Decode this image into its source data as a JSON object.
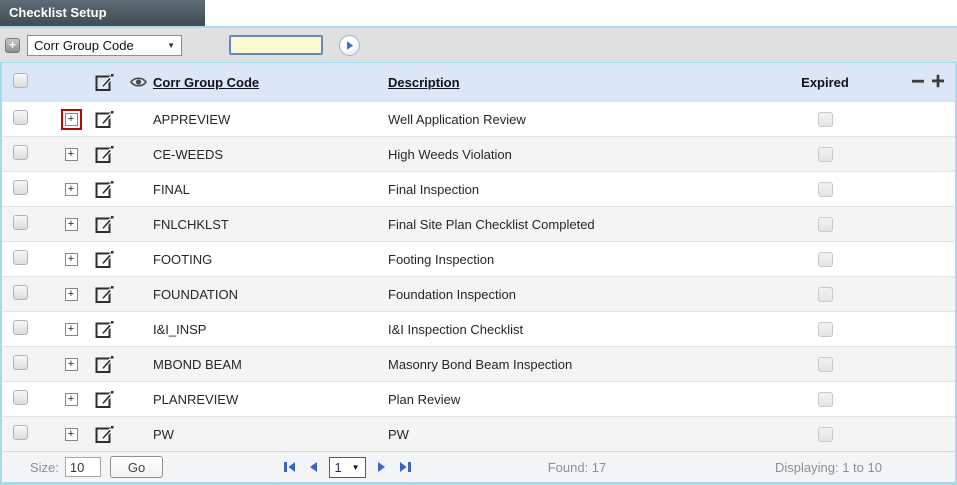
{
  "panel": {
    "title": "Checklist Setup"
  },
  "toolbar": {
    "add_button_glyph": "+",
    "field_selector": {
      "value": "Corr Group Code",
      "arrow_glyph": "▼"
    },
    "search_input": {
      "value": ""
    }
  },
  "table": {
    "header": {
      "code": "Corr Group Code",
      "description": "Description",
      "expired": "Expired",
      "remove_glyph": "−",
      "add_glyph": "+"
    },
    "expand_glyph": "+",
    "rows": [
      {
        "code": "APPREVIEW",
        "description": "Well Application Review",
        "expired": false,
        "expand_highlighted": true
      },
      {
        "code": "CE-WEEDS",
        "description": "High Weeds Violation",
        "expired": false
      },
      {
        "code": "FINAL",
        "description": "Final Inspection",
        "expired": false
      },
      {
        "code": "FNLCHKLST",
        "description": "Final Site Plan Checklist Completed",
        "expired": false
      },
      {
        "code": "FOOTING",
        "description": "Footing Inspection",
        "expired": false
      },
      {
        "code": "FOUNDATION",
        "description": "Foundation Inspection",
        "expired": false
      },
      {
        "code": "I&I_INSP",
        "description": "I&I Inspection Checklist",
        "expired": false
      },
      {
        "code": "MBOND BEAM",
        "description": "Masonry Bond Beam Inspection",
        "expired": false
      },
      {
        "code": "PLANREVIEW",
        "description": "Plan Review",
        "expired": false
      },
      {
        "code": "PW",
        "description": "PW",
        "expired": false
      }
    ]
  },
  "footer": {
    "size_label": "Size:",
    "size_value": "10",
    "go_label": "Go",
    "page_selector": {
      "value": "1",
      "arrow_glyph": "▼"
    },
    "found_text": "Found: 17",
    "displaying_text": "Displaying: 1 to 10"
  },
  "colors": {
    "tab_bg": "#49565e",
    "accent_border": "#a5d9ec",
    "header_row_bg": "#dbe7f7",
    "search_input_bg": "#fbfad2",
    "search_input_border": "#5f8ac7",
    "pagination_blue": "#3b63c4",
    "highlight_red": "#b30b00",
    "alt_row_bg": "#f4f4f4"
  }
}
